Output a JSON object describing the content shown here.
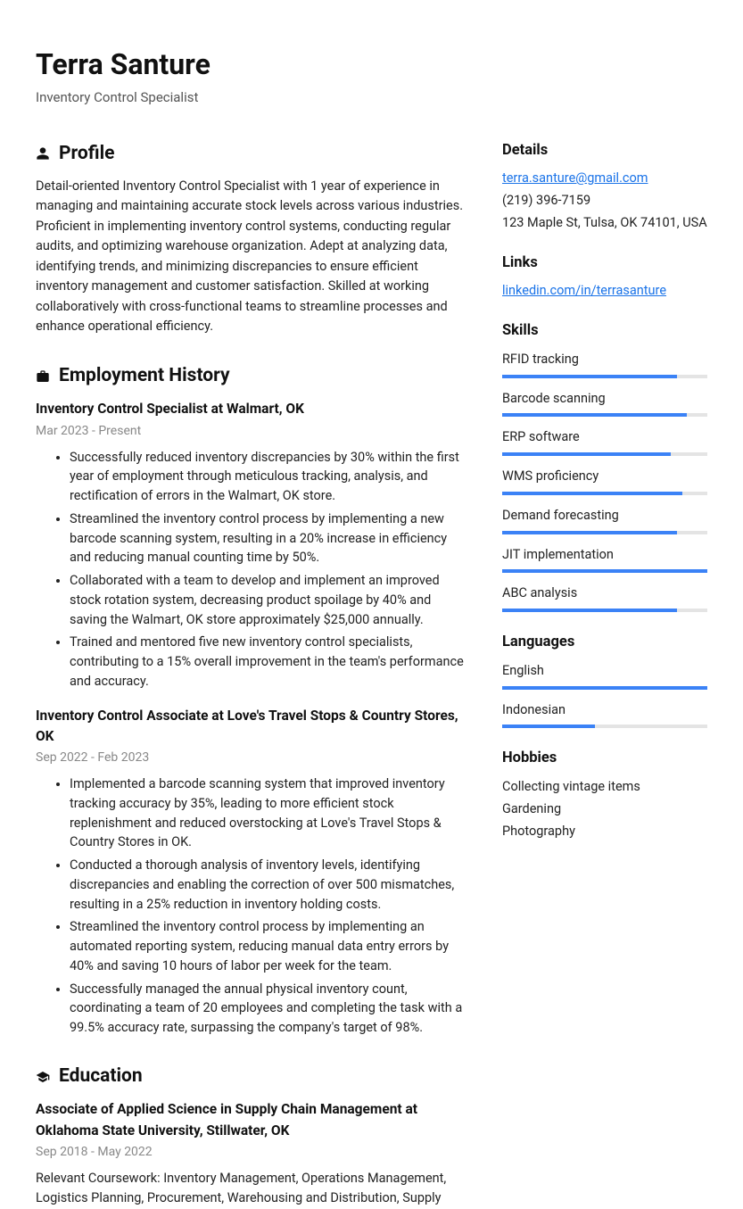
{
  "header": {
    "name": "Terra Santure",
    "title": "Inventory Control Specialist"
  },
  "profile": {
    "section_title": "Profile",
    "text": "Detail-oriented Inventory Control Specialist with 1 year of experience in managing and maintaining accurate stock levels across various industries. Proficient in implementing inventory control systems, conducting regular audits, and optimizing warehouse organization. Adept at analyzing data, identifying trends, and minimizing discrepancies to ensure efficient inventory management and customer satisfaction. Skilled at working collaboratively with cross-functional teams to streamline processes and enhance operational efficiency."
  },
  "employment": {
    "section_title": "Employment History",
    "jobs": [
      {
        "title": "Inventory Control Specialist at Walmart, OK",
        "dates": "Mar 2023 - Present",
        "bullets": [
          "Successfully reduced inventory discrepancies by 30% within the first year of employment through meticulous tracking, analysis, and rectification of errors in the Walmart, OK store.",
          "Streamlined the inventory control process by implementing a new barcode scanning system, resulting in a 20% increase in efficiency and reducing manual counting time by 50%.",
          "Collaborated with a team to develop and implement an improved stock rotation system, decreasing product spoilage by 40% and saving the Walmart, OK store approximately $25,000 annually.",
          "Trained and mentored five new inventory control specialists, contributing to a 15% overall improvement in the team's performance and accuracy."
        ]
      },
      {
        "title": "Inventory Control Associate at Love's Travel Stops & Country Stores, OK",
        "dates": "Sep 2022 - Feb 2023",
        "bullets": [
          "Implemented a barcode scanning system that improved inventory tracking accuracy by 35%, leading to more efficient stock replenishment and reduced overstocking at Love's Travel Stops & Country Stores in OK.",
          "Conducted a thorough analysis of inventory levels, identifying discrepancies and enabling the correction of over 500 mismatches, resulting in a 25% reduction in inventory holding costs.",
          "Streamlined the inventory control process by implementing an automated reporting system, reducing manual data entry errors by 40% and saving 10 hours of labor per week for the team.",
          "Successfully managed the annual physical inventory count, coordinating a team of 20 employees and completing the task with a 99.5% accuracy rate, surpassing the company's target of 98%."
        ]
      }
    ]
  },
  "education": {
    "section_title": "Education",
    "entries": [
      {
        "title": "Associate of Applied Science in Supply Chain Management at Oklahoma State University, Stillwater, OK",
        "dates": "Sep 2018 - May 2022",
        "desc": "Relevant Coursework: Inventory Management, Operations Management, Logistics Planning, Procurement, Warehousing and Distribution, Supply"
      }
    ]
  },
  "details": {
    "section_title": "Details",
    "email": "terra.santure@gmail.com",
    "phone": "(219) 396-7159",
    "address": "123 Maple St, Tulsa, OK 74101, USA"
  },
  "links": {
    "section_title": "Links",
    "items": [
      "linkedin.com/in/terrasanture"
    ]
  },
  "skills": {
    "section_title": "Skills",
    "items": [
      {
        "name": "RFID tracking",
        "level": 85
      },
      {
        "name": "Barcode scanning",
        "level": 90
      },
      {
        "name": "ERP software",
        "level": 82
      },
      {
        "name": "WMS proficiency",
        "level": 88
      },
      {
        "name": "Demand forecasting",
        "level": 85
      },
      {
        "name": "JIT implementation",
        "level": 100
      },
      {
        "name": "ABC analysis",
        "level": 85
      }
    ]
  },
  "languages": {
    "section_title": "Languages",
    "items": [
      {
        "name": "English",
        "level": 100
      },
      {
        "name": "Indonesian",
        "level": 45
      }
    ]
  },
  "hobbies": {
    "section_title": "Hobbies",
    "items": [
      "Collecting vintage items",
      "Gardening",
      "Photography"
    ]
  }
}
